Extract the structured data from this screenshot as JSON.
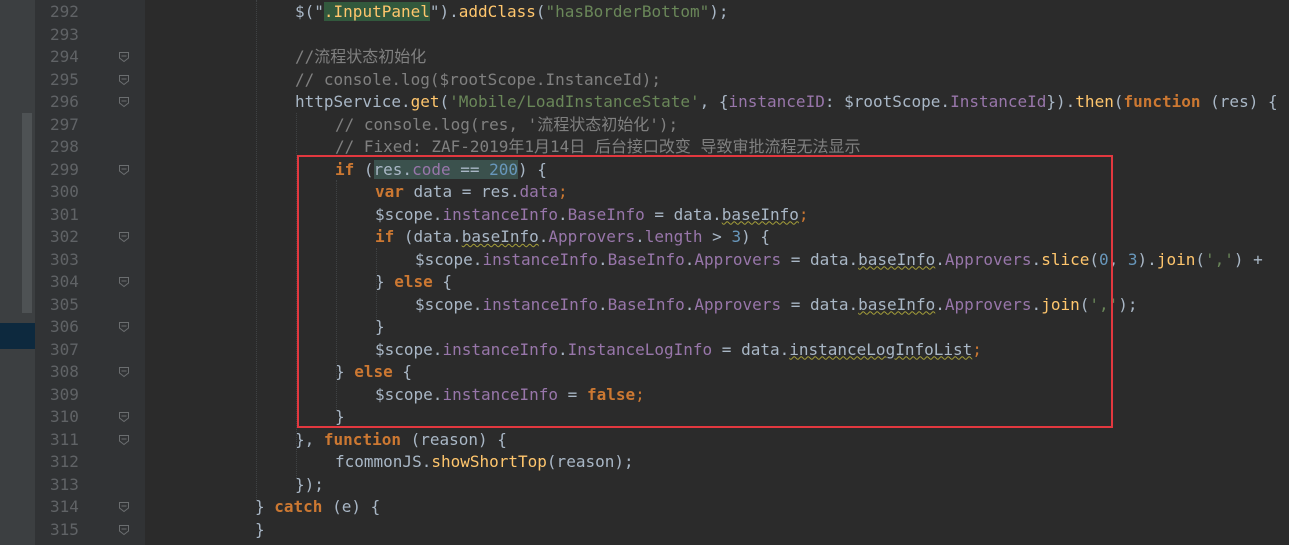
{
  "editor": {
    "lines": [
      {
        "n": "292",
        "indent": 9,
        "tokens": [
          {
            "t": "$(\"",
            "c": ""
          },
          {
            "t": ".InputPanel",
            "c": "fn hl-sel"
          },
          {
            "t": "\").",
            "c": "str2"
          },
          {
            "t": "addClass",
            "c": "fn"
          },
          {
            "t": "(",
            "c": ""
          },
          {
            "t": "\"hasBorderBottom\"",
            "c": "str"
          },
          {
            "t": ");",
            "c": ""
          }
        ]
      },
      {
        "n": "293",
        "indent": 0,
        "tokens": []
      },
      {
        "n": "294",
        "indent": 9,
        "tokens": [
          {
            "t": "//流程状态初始化",
            "c": "cmt"
          }
        ]
      },
      {
        "n": "295",
        "indent": 9,
        "tokens": [
          {
            "t": "// console.log($rootScope.InstanceId);",
            "c": "cmt"
          }
        ]
      },
      {
        "n": "296",
        "indent": 9,
        "tokens": [
          {
            "t": "httpService.",
            "c": ""
          },
          {
            "t": "get",
            "c": "fn"
          },
          {
            "t": "(",
            "c": ""
          },
          {
            "t": "'Mobile/LoadInstanceState'",
            "c": "str"
          },
          {
            "t": ", {",
            "c": ""
          },
          {
            "t": "instanceID",
            "c": "prop"
          },
          {
            "t": ": $rootScope.",
            "c": ""
          },
          {
            "t": "InstanceId",
            "c": "prop"
          },
          {
            "t": "}).",
            "c": ""
          },
          {
            "t": "then",
            "c": "fn"
          },
          {
            "t": "(",
            "c": ""
          },
          {
            "t": "function",
            "c": "kw"
          },
          {
            "t": " (res) {",
            "c": ""
          }
        ]
      },
      {
        "n": "297",
        "indent": 13,
        "tokens": [
          {
            "t": "// console.log(res, '流程状态初始化');",
            "c": "cmt"
          }
        ]
      },
      {
        "n": "298",
        "indent": 13,
        "tokens": [
          {
            "t": "// Fixed: ZAF-2019年1月14日 后台接口改变 导致审批流程无法显示",
            "c": "cmt"
          }
        ]
      },
      {
        "n": "299",
        "indent": 13,
        "tokens": [
          {
            "t": "if",
            "c": "kw"
          },
          {
            "t": " (",
            "c": ""
          },
          {
            "t": "res.",
            "c": "hl-var"
          },
          {
            "t": "code",
            "c": "prop hl-var"
          },
          {
            "t": " == ",
            "c": "hl-var"
          },
          {
            "t": "200",
            "c": "num hl-var"
          },
          {
            "t": ") {",
            "c": ""
          }
        ]
      },
      {
        "n": "300",
        "indent": 17,
        "tokens": [
          {
            "t": "var",
            "c": "kw"
          },
          {
            "t": " data = res.",
            "c": ""
          },
          {
            "t": "data",
            "c": "prop"
          },
          {
            "t": ";",
            "c": "kwn"
          }
        ]
      },
      {
        "n": "301",
        "indent": 17,
        "tokens": [
          {
            "t": "$scope.",
            "c": ""
          },
          {
            "t": "instanceInfo",
            "c": "prop"
          },
          {
            "t": ".",
            "c": ""
          },
          {
            "t": "BaseInfo",
            "c": "prop"
          },
          {
            "t": " = data.",
            "c": ""
          },
          {
            "t": "baseInfo",
            "c": "warn"
          },
          {
            "t": ";",
            "c": "kwn"
          }
        ]
      },
      {
        "n": "302",
        "indent": 17,
        "tokens": [
          {
            "t": "if",
            "c": "kw"
          },
          {
            "t": " (data.",
            "c": ""
          },
          {
            "t": "baseInfo",
            "c": "warn"
          },
          {
            "t": ".",
            "c": ""
          },
          {
            "t": "Approvers",
            "c": "prop"
          },
          {
            "t": ".",
            "c": ""
          },
          {
            "t": "length",
            "c": "prop"
          },
          {
            "t": " > ",
            "c": ""
          },
          {
            "t": "3",
            "c": "num"
          },
          {
            "t": ") {",
            "c": ""
          }
        ]
      },
      {
        "n": "303",
        "indent": 21,
        "tokens": [
          {
            "t": "$scope.",
            "c": ""
          },
          {
            "t": "instanceInfo",
            "c": "prop"
          },
          {
            "t": ".",
            "c": ""
          },
          {
            "t": "BaseInfo",
            "c": "prop"
          },
          {
            "t": ".",
            "c": ""
          },
          {
            "t": "Approvers",
            "c": "prop"
          },
          {
            "t": " = data.",
            "c": ""
          },
          {
            "t": "baseInfo",
            "c": "warn"
          },
          {
            "t": ".",
            "c": ""
          },
          {
            "t": "Approvers",
            "c": "prop"
          },
          {
            "t": ".",
            "c": ""
          },
          {
            "t": "slice",
            "c": "fn"
          },
          {
            "t": "(",
            "c": ""
          },
          {
            "t": "0",
            "c": "num"
          },
          {
            "t": ", ",
            "c": ""
          },
          {
            "t": "3",
            "c": "num"
          },
          {
            "t": ").",
            "c": ""
          },
          {
            "t": "join",
            "c": "fn"
          },
          {
            "t": "(",
            "c": ""
          },
          {
            "t": "','",
            "c": "str"
          },
          {
            "t": ") +",
            "c": ""
          }
        ]
      },
      {
        "n": "304",
        "indent": 17,
        "tokens": [
          {
            "t": "} ",
            "c": ""
          },
          {
            "t": "else",
            "c": "kw"
          },
          {
            "t": " {",
            "c": ""
          }
        ]
      },
      {
        "n": "305",
        "indent": 21,
        "tokens": [
          {
            "t": "$scope.",
            "c": ""
          },
          {
            "t": "instanceInfo",
            "c": "prop"
          },
          {
            "t": ".",
            "c": ""
          },
          {
            "t": "BaseInfo",
            "c": "prop"
          },
          {
            "t": ".",
            "c": ""
          },
          {
            "t": "Approvers",
            "c": "prop"
          },
          {
            "t": " = data.",
            "c": ""
          },
          {
            "t": "baseInfo",
            "c": "warn"
          },
          {
            "t": ".",
            "c": ""
          },
          {
            "t": "Approvers",
            "c": "prop"
          },
          {
            "t": ".",
            "c": ""
          },
          {
            "t": "join",
            "c": "fn"
          },
          {
            "t": "(",
            "c": ""
          },
          {
            "t": "','",
            "c": "str"
          },
          {
            "t": ");",
            "c": ""
          }
        ]
      },
      {
        "n": "306",
        "indent": 17,
        "tokens": [
          {
            "t": "}",
            "c": ""
          }
        ]
      },
      {
        "n": "307",
        "indent": 17,
        "tokens": [
          {
            "t": "$scope.",
            "c": ""
          },
          {
            "t": "instanceInfo",
            "c": "prop"
          },
          {
            "t": ".",
            "c": ""
          },
          {
            "t": "InstanceLogInfo",
            "c": "prop"
          },
          {
            "t": " = data.",
            "c": ""
          },
          {
            "t": "instanceLogInfoList",
            "c": "warn"
          },
          {
            "t": ";",
            "c": "kwn"
          }
        ]
      },
      {
        "n": "308",
        "indent": 13,
        "tokens": [
          {
            "t": "} ",
            "c": ""
          },
          {
            "t": "else",
            "c": "kw"
          },
          {
            "t": " {",
            "c": ""
          }
        ]
      },
      {
        "n": "309",
        "indent": 17,
        "tokens": [
          {
            "t": "$scope.",
            "c": ""
          },
          {
            "t": "instanceInfo",
            "c": "prop"
          },
          {
            "t": " = ",
            "c": ""
          },
          {
            "t": "false",
            "c": "kw"
          },
          {
            "t": ";",
            "c": "kwn"
          }
        ]
      },
      {
        "n": "310",
        "indent": 13,
        "tokens": [
          {
            "t": "}",
            "c": ""
          }
        ]
      },
      {
        "n": "311",
        "indent": 9,
        "tokens": [
          {
            "t": "}, ",
            "c": ""
          },
          {
            "t": "function",
            "c": "kw"
          },
          {
            "t": " (reason) {",
            "c": ""
          }
        ]
      },
      {
        "n": "312",
        "indent": 13,
        "tokens": [
          {
            "t": "fcommonJS.",
            "c": ""
          },
          {
            "t": "showShortTop",
            "c": "fn"
          },
          {
            "t": "(reason);",
            "c": ""
          }
        ]
      },
      {
        "n": "313",
        "indent": 9,
        "tokens": [
          {
            "t": "});",
            "c": ""
          }
        ]
      },
      {
        "n": "314",
        "indent": 5,
        "tokens": [
          {
            "t": "} ",
            "c": ""
          },
          {
            "t": "catch",
            "c": "kw"
          },
          {
            "t": " (e) {",
            "c": ""
          }
        ]
      },
      {
        "n": "315",
        "indent": 5,
        "tokens": [
          {
            "t": "}",
            "c": ""
          }
        ]
      }
    ],
    "fold_lines": [
      "294",
      "295",
      "296",
      "299",
      "302",
      "304",
      "306",
      "308",
      "310",
      "311",
      "314",
      "315"
    ],
    "colors": {
      "background": "#2b2b2b",
      "gutter": "#313335",
      "keyword": "#cc7832",
      "function": "#ffc66d",
      "string": "#6a8759",
      "property": "#9876aa",
      "number": "#6897bb",
      "comment": "#808080",
      "highlight_box": "#e2383f"
    }
  }
}
